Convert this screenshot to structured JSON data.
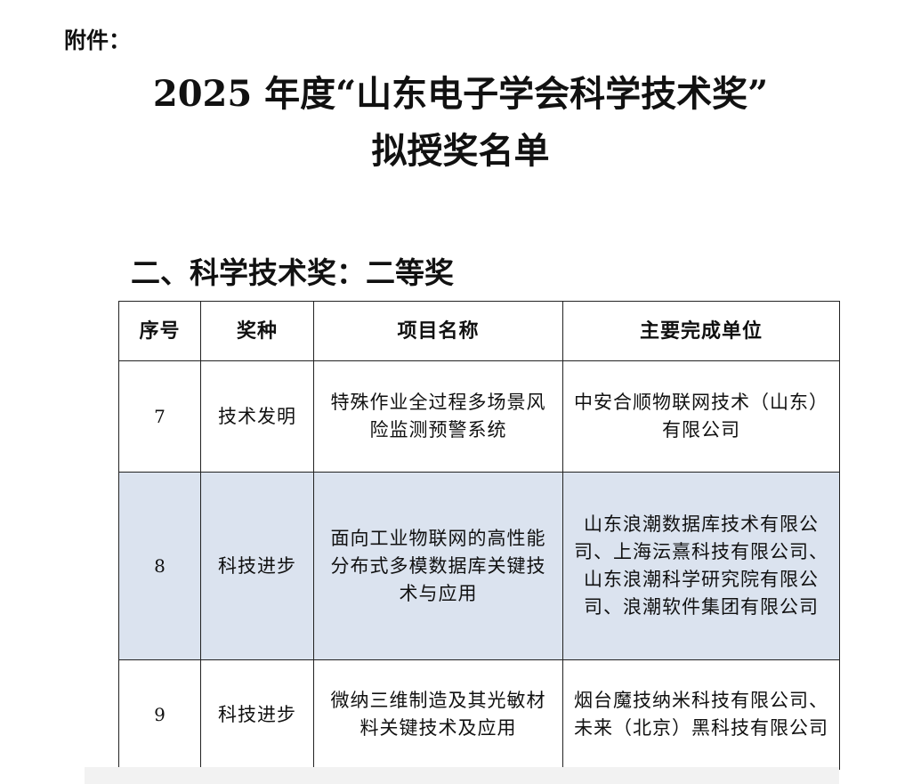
{
  "attachment_label": "附件：",
  "title": {
    "line1": "2025 年度“山东电子学会科学技术奖”",
    "line2": "拟授奖名单"
  },
  "section_heading": "二、科学技术奖：二等奖",
  "table": {
    "headers": [
      "序号",
      "奖种",
      "项目名称",
      "主要完成单位"
    ],
    "rows": [
      {
        "no": "7",
        "type": "技术发明",
        "project": "特殊作业全过程多场景风险监测预警系统",
        "units": "中安合顺物联网技术（山东）有限公司"
      },
      {
        "no": "8",
        "type": "科技进步",
        "project": "面向工业物联网的高性能分布式多模数据库关键技术与应用",
        "units": "山东浪潮数据库技术有限公司、上海沄熹科技有限公司、山东浪潮科学研究院有限公司、浪潮软件集团有限公司"
      },
      {
        "no": "9",
        "type": "科技进步",
        "project": "微纳三维制造及其光敏材料关键技术及应用",
        "units": "烟台魔技纳米科技有限公司、未来（北京）黑科技有限公司"
      }
    ]
  },
  "colors": {
    "highlight_row": "#dbe3ef",
    "border": "#222222"
  }
}
